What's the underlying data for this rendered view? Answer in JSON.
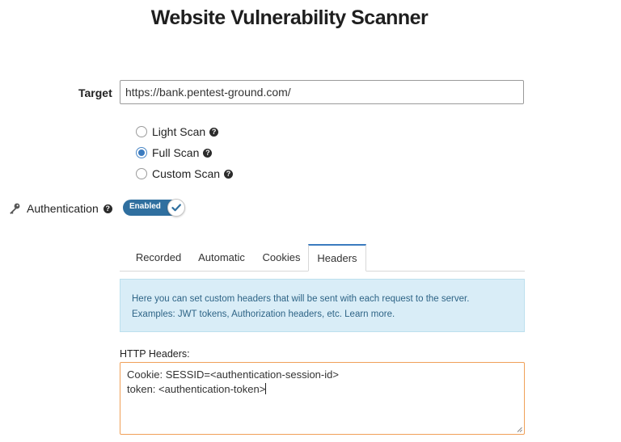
{
  "title": "Website Vulnerability Scanner",
  "target": {
    "label": "Target",
    "value": "https://bank.pentest-ground.com/"
  },
  "scan_types": [
    {
      "label": "Light Scan",
      "checked": false,
      "help_icon": "question-circle-icon"
    },
    {
      "label": "Full Scan",
      "checked": true,
      "help_icon": "question-circle-icon"
    },
    {
      "label": "Custom Scan",
      "checked": false,
      "help_icon": "question-circle-icon"
    }
  ],
  "auth": {
    "icon": "key-icon",
    "label": "Authentication",
    "help_icon": "question-circle-icon",
    "toggle_label": "Enabled",
    "toggle_on": true
  },
  "tabs": [
    {
      "label": "Recorded",
      "active": false
    },
    {
      "label": "Automatic",
      "active": false
    },
    {
      "label": "Cookies",
      "active": false
    },
    {
      "label": "Headers",
      "active": true
    }
  ],
  "info": {
    "line1": "Here you can set custom headers that will be sent with each request to the server.",
    "line2": "Examples: JWT tokens, Authorization headers, etc.",
    "learn_more": "Learn more."
  },
  "headers": {
    "label": "HTTP Headers:",
    "line1": "Cookie: SESSID=<authentication-session-id>",
    "line2": "token: <authentication-token>"
  },
  "colors": {
    "accent": "#3b7bbf",
    "toggle_bg": "#2f6f9f",
    "info_bg": "#d9edf7",
    "focus_border": "#f0a058"
  }
}
